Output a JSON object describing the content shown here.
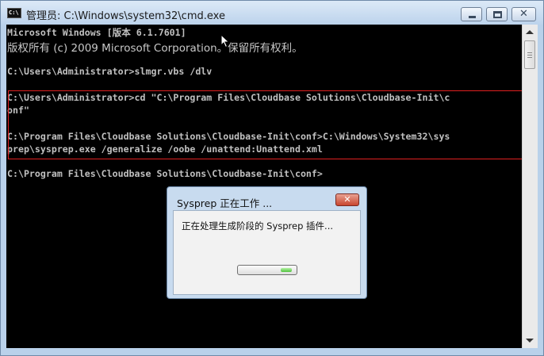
{
  "window": {
    "title": "管理员: C:\\Windows\\system32\\cmd.exe",
    "icon": "cmd-icon",
    "icon_text": "C:\\",
    "minimize_icon": "minimize-icon",
    "maximize_icon": "maximize-icon",
    "close_icon": "close-icon",
    "close_glyph": "✕"
  },
  "console": {
    "lines": [
      "Microsoft Windows [版本 6.1.7601]",
      "版权所有 (c) 2009 Microsoft Corporation。保留所有权利。",
      "",
      "C:\\Users\\Administrator>slmgr.vbs /dlv",
      "",
      "C:\\Users\\Administrator>cd \"C:\\Program Files\\Cloudbase Solutions\\Cloudbase-Init\\c",
      "onf\"",
      "",
      "C:\\Program Files\\Cloudbase Solutions\\Cloudbase-Init\\conf>C:\\Windows\\System32\\sys",
      "prep\\sysprep.exe /generalize /oobe /unattend:Unattend.xml",
      "",
      "C:\\Program Files\\Cloudbase Solutions\\Cloudbase-Init\\conf>"
    ],
    "text_color": "#c0c0c0",
    "background": "#000000",
    "highlight_color": "#e02020"
  },
  "dialog": {
    "title": "Sysprep 正在工作 ...",
    "close_glyph": "✕",
    "message": "正在处理生成阶段的 Sysprep 插件...",
    "progress_fraction": 0.2,
    "progress_color": "#4fc23c"
  },
  "scrollbar": {
    "up_icon": "scroll-up-icon",
    "down_icon": "scroll-down-icon"
  },
  "mouse_cursor": "arrow-cursor-icon"
}
